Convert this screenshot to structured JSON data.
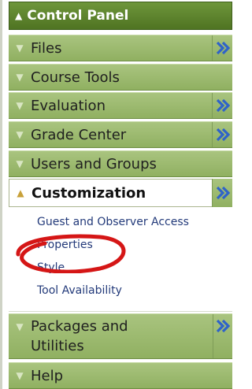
{
  "panel": {
    "title": "Control Panel",
    "items": [
      {
        "label": "Files",
        "icon": "chevron-down-icon",
        "has_expander": true
      },
      {
        "label": "Course Tools",
        "icon": "chevron-down-icon",
        "has_expander": false
      },
      {
        "label": "Evaluation",
        "icon": "chevron-down-icon",
        "has_expander": true
      },
      {
        "label": "Grade Center",
        "icon": "chevron-down-icon",
        "has_expander": true
      },
      {
        "label": "Users and Groups",
        "icon": "chevron-down-icon",
        "has_expander": false
      }
    ],
    "active": {
      "label": "Customization",
      "icon": "chevron-up-icon",
      "subitems": [
        "Guest and Observer Access",
        "Properties",
        "Style",
        "Tool Availability"
      ]
    },
    "lower_items": [
      {
        "label_line1": "Packages and",
        "label_line2": "Utilities",
        "has_expander": true
      },
      {
        "label": "Help",
        "has_expander": false
      }
    ]
  },
  "colors": {
    "header_green": "#5b8129",
    "row_green": "#9cba6f",
    "expander_blue": "#2f63c9",
    "annotation_red": "#d51616",
    "link_blue": "#233a7a"
  }
}
